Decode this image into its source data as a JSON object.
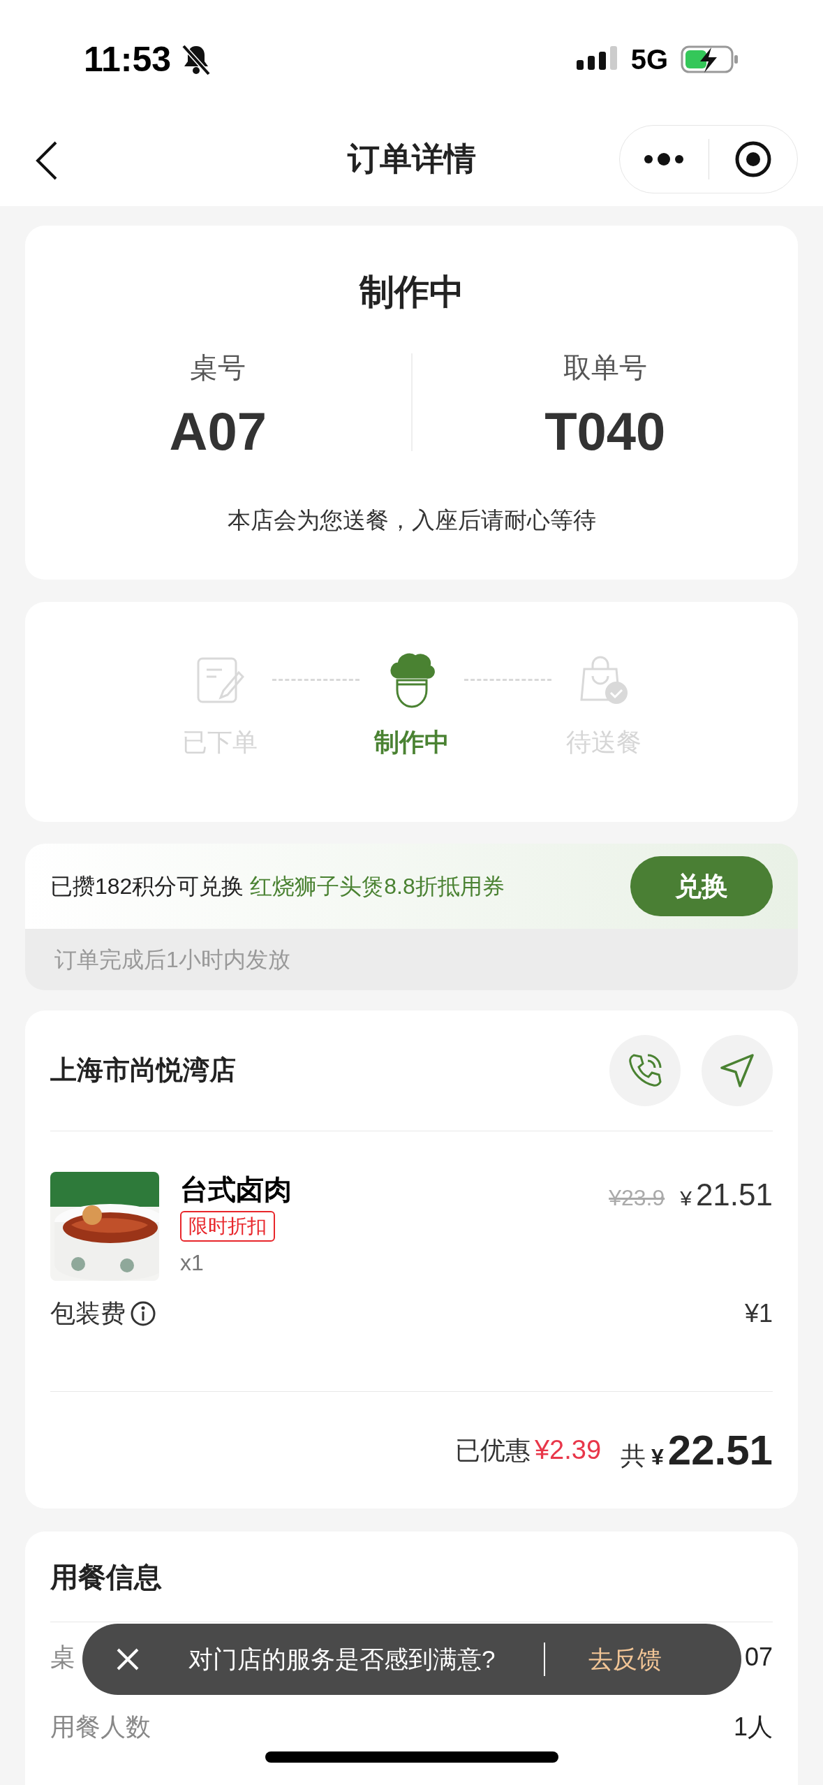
{
  "status_bar": {
    "time": "11:53",
    "network": "5G"
  },
  "nav": {
    "title": "订单详情"
  },
  "order_status": {
    "title": "制作中",
    "fields": [
      {
        "label": "桌号",
        "value": "A07"
      },
      {
        "label": "取单号",
        "value": "T040"
      }
    ],
    "note": "本店会为您送餐，入座后请耐心等待"
  },
  "progress": {
    "steps": [
      {
        "kind": "placed",
        "label": "已下单",
        "selected": false
      },
      {
        "kind": "cooking",
        "label": "制作中",
        "selected": true
      },
      {
        "kind": "delivery",
        "label": "待送餐",
        "selected": false
      }
    ]
  },
  "points_promo": {
    "text": "已攒182积分可兑换",
    "highlight": "红烧狮子头煲8.8折抵用券",
    "button": "兑换",
    "footnote": "订单完成后1小时内发放"
  },
  "store": {
    "name": "上海市尚悦湾店",
    "items": [
      {
        "kind": "picture",
        "name": "台式卤肉",
        "tag": "限时折扣",
        "quantity": "x1",
        "original_price": "¥23.9",
        "currency": "¥",
        "price": "21.51"
      }
    ],
    "packing_fee": {
      "label": "包装费",
      "value": "¥1"
    },
    "summary": {
      "discount_label": "已优惠",
      "discount": "¥2.39",
      "total_label": "共",
      "currency": "¥",
      "total": "22.51"
    }
  },
  "dining_info": {
    "title": "用餐信息",
    "rows": [
      {
        "label": "桌",
        "value": "07"
      },
      {
        "label": "用餐人数",
        "value": "1人"
      }
    ]
  },
  "toast": {
    "message": "对门店的服务是否感到满意?",
    "action": "去反馈"
  }
}
